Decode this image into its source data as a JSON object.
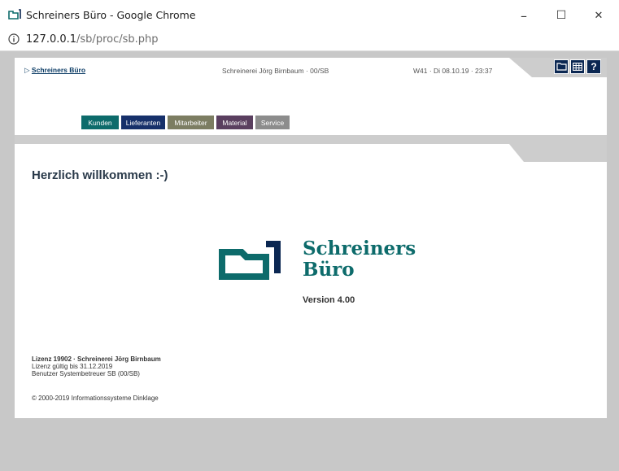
{
  "window": {
    "title": "Schreiners Büro - Google Chrome",
    "minimize": "–",
    "maximize": "☐",
    "close": "✕"
  },
  "address": {
    "host": "127.0.0.1",
    "path": "/sb/proc/sb.php",
    "info_icon": "info-icon"
  },
  "header": {
    "breadcrumb_marker": "▷",
    "breadcrumb_link": "Schreiners Büro",
    "company": "Schreinerei Jörg Birnbaum · 00/SB",
    "date": "W41 · Di 08.10.19 · 23:37",
    "help_label": "?"
  },
  "menu": [
    {
      "label": "Kunden",
      "color": "#0d6b6b"
    },
    {
      "label": "Lieferanten",
      "color": "#16306a"
    },
    {
      "label": "Mitarbeiter",
      "color": "#7c7d62"
    },
    {
      "label": "Material",
      "color": "#5a3f5f"
    },
    {
      "label": "Service",
      "color": "#8c8c8c"
    }
  ],
  "main": {
    "welcome": "Herzlich willkommen :-)",
    "brand_line1": "Schreiners",
    "brand_line2": "Büro",
    "version": "Version 4.00",
    "license_line1": "Lizenz 19902 · Schreinerei Jörg Birnbaum",
    "license_line2": "Lizenz gültig bis 31.12.2019",
    "license_line3": "Benutzer Systembetreuer SB (00/SB)",
    "copyright": "© 2000-2019 Informationssysteme Dinklage"
  },
  "colors": {
    "accent_teal": "#0d6b6b",
    "navy": "#0b2752"
  }
}
